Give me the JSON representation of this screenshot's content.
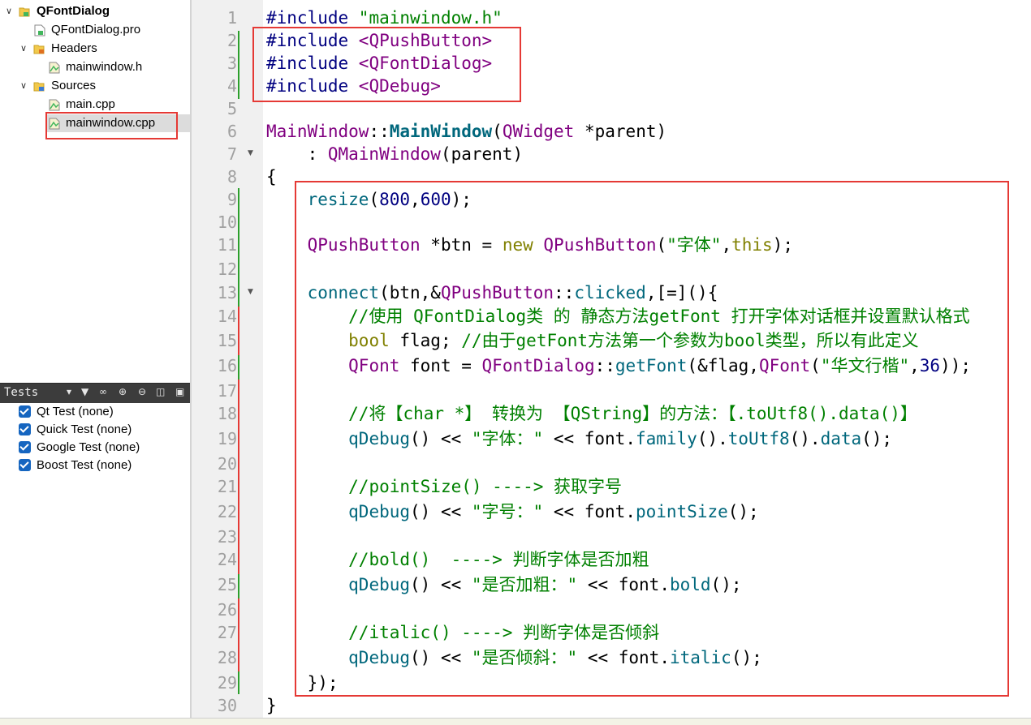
{
  "project_tree": {
    "project_name": "QFontDialog",
    "pro_file": "QFontDialog.pro",
    "headers_label": "Headers",
    "header_file": "mainwindow.h",
    "sources_label": "Sources",
    "source_files": [
      "main.cpp",
      "mainwindow.cpp"
    ],
    "selected_file": "mainwindow.cpp"
  },
  "tests_panel": {
    "title": "Tests",
    "items": [
      {
        "label": "Qt Test (none)",
        "checked": true
      },
      {
        "label": "Quick Test (none)",
        "checked": true
      },
      {
        "label": "Google Test (none)",
        "checked": true
      },
      {
        "label": "Boost Test (none)",
        "checked": true
      }
    ]
  },
  "editor": {
    "line_numbers": [
      "1",
      "2",
      "3",
      "4",
      "5",
      "6",
      "7",
      "8",
      "9",
      "10",
      "11",
      "12",
      "13",
      "14",
      "15",
      "16",
      "17",
      "18",
      "19",
      "20",
      "21",
      "22",
      "23",
      "24",
      "25",
      "26",
      "27",
      "28",
      "29",
      "30"
    ],
    "lines": [
      "#include \"mainwindow.h\"",
      "#include <QPushButton>",
      "#include <QFontDialog>",
      "#include <QDebug>",
      "",
      "MainWindow::MainWindow(QWidget *parent)",
      "    : QMainWindow(parent)",
      "{",
      "    resize(800,600);",
      "",
      "    QPushButton *btn = new QPushButton(\"字体\",this);",
      "",
      "    connect(btn,&QPushButton::clicked,[=](){",
      "        //使用 QFontDialog类 的 静态方法getFont 打开字体对话框并设置默认格式",
      "        bool flag; //由于getFont方法第一个参数为bool类型，所以有此定义",
      "        QFont font = QFontDialog::getFont(&flag,QFont(\"华文行楷\",36));",
      "",
      "        //将【char *】 转换为 【QString】的方法：【.toUtf8().data()】",
      "        qDebug() << \"字体：\" << font.family().toUtf8().data();",
      "",
      "        //pointSize() ----> 获取字号",
      "        qDebug() << \"字号：\" << font.pointSize();",
      "",
      "        //bold()  ----> 判断字体是否加粗",
      "        qDebug() << \"是否加粗：\" << font.bold();",
      "",
      "        //italic() ----> 判断字体是否倾斜",
      "        qDebug() << \"是否倾斜：\" << font.italic();",
      "    });",
      "}"
    ]
  },
  "colors": {
    "annotation_red": "#e53935",
    "preprocessor": "#000080",
    "string": "#008000",
    "type": "#800080",
    "keyword": "#808000",
    "function": "#00677c",
    "comment": "#008000",
    "gutter_added": "#2ca02c",
    "gutter_modified": "#e53935"
  },
  "icons": {
    "project": "qt-project-icon",
    "pro_file": "pro-file-icon",
    "headers_folder": "header-folder-icon",
    "sources_folder": "source-folder-icon",
    "cpp_file": "cpp-file-icon"
  }
}
